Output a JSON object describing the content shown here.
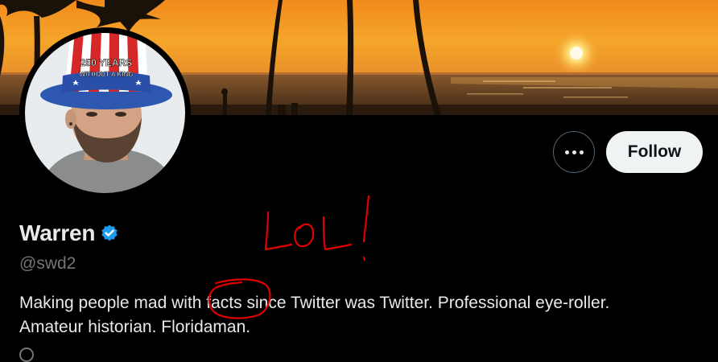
{
  "profile": {
    "display_name": "Warren",
    "handle": "@swd2",
    "bio_lines": [
      "Making people mad with facts since Twitter was Twitter. Professional eye-roller.",
      "Amateur historian. Floridaman."
    ],
    "verified": true
  },
  "avatar": {
    "hat_text_line1": "250 YEARS",
    "hat_text_line2": "WITHOUT A KING"
  },
  "actions": {
    "more_icon": "ellipsis-icon",
    "follow_label": "Follow"
  },
  "annotation": {
    "scribble_text": "LOL!",
    "circled_word": "facts",
    "color": "#e00000"
  },
  "colors": {
    "background": "#000000",
    "text_primary": "#e7e9ea",
    "text_secondary": "#71767b",
    "verified_blue": "#1d9bf0",
    "follow_bg": "#eff3f4"
  }
}
